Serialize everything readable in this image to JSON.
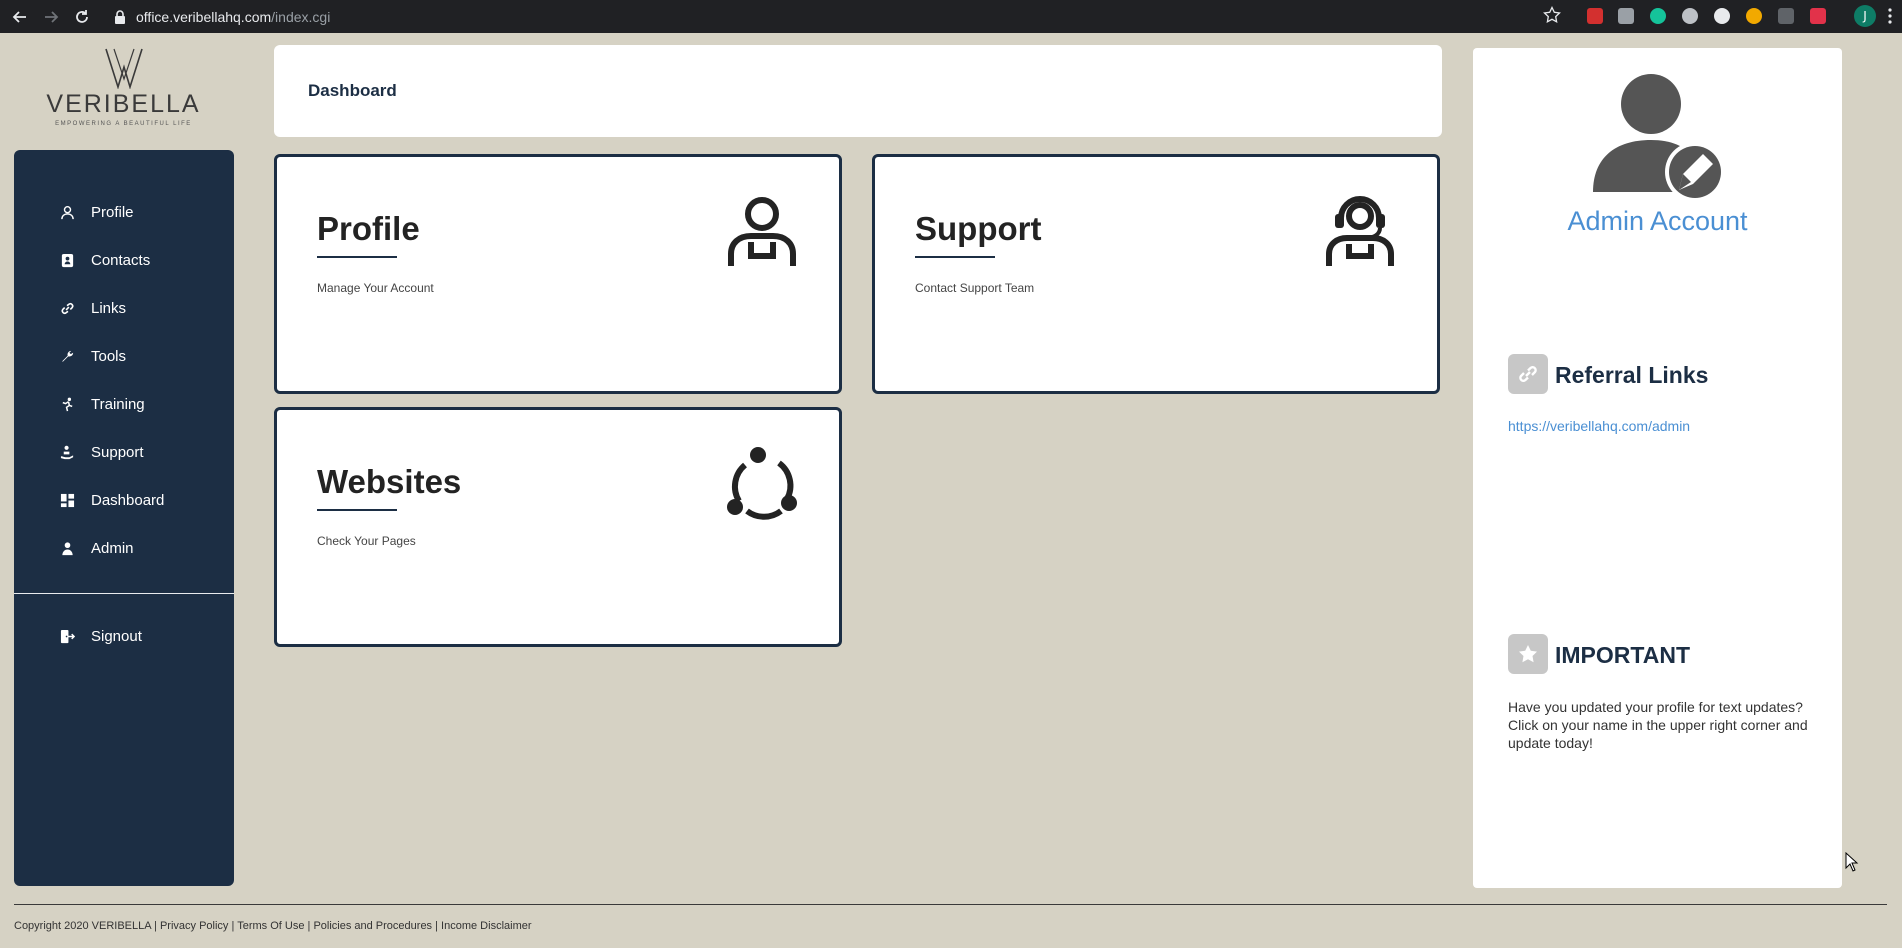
{
  "browser": {
    "url_host": "office.veribellahq.com",
    "url_path": "/index.cgi",
    "profile_initial": "J",
    "extensions": [
      "adblock-icon",
      "camera-icon",
      "grammarly-icon",
      "extension-icon",
      "pen-icon",
      "chrome-icon",
      "code-icon",
      "tool-icon"
    ]
  },
  "logo": {
    "name": "VERIBELLA",
    "tagline": "EMPOWERING A BEAUTIFUL LIFE"
  },
  "sidebar": {
    "items": [
      {
        "label": "Profile",
        "icon": "user-icon"
      },
      {
        "label": "Contacts",
        "icon": "address-book-icon"
      },
      {
        "label": "Links",
        "icon": "link-icon"
      },
      {
        "label": "Tools",
        "icon": "wrench-icon"
      },
      {
        "label": "Training",
        "icon": "runner-icon"
      },
      {
        "label": "Support",
        "icon": "support-icon"
      },
      {
        "label": "Dashboard",
        "icon": "dashboard-icon"
      },
      {
        "label": "Admin",
        "icon": "admin-icon"
      }
    ],
    "signout": {
      "label": "Signout",
      "icon": "signout-icon"
    }
  },
  "header": {
    "title": "Dashboard"
  },
  "tiles": [
    {
      "title": "Profile",
      "description": "Manage Your Account",
      "icon": "user-outline-icon"
    },
    {
      "title": "Support",
      "description": "Contact Support Team",
      "icon": "headset-agent-icon"
    },
    {
      "title": "Websites",
      "description": "Check Your Pages",
      "icon": "network-cycle-icon"
    }
  ],
  "right_panel": {
    "account_name": "Admin Account",
    "referral": {
      "title": "Referral Links",
      "link": "https://veribellahq.com/admin"
    },
    "important": {
      "title": "IMPORTANT",
      "text": "Have you updated your profile for text updates? Click on your name in the upper right corner and update today!"
    }
  },
  "footer": {
    "copyright": "Copyright 2020 VERIBELLA",
    "links": [
      "Privacy Policy",
      "Terms Of Use",
      "Policies and Procedures",
      "Income Disclaimer"
    ]
  },
  "colors": {
    "page_bg": "#d6d2c4",
    "sidebar_bg": "#1c2e44",
    "accent_link": "#4a8fd3",
    "card_bg": "#ffffff"
  }
}
